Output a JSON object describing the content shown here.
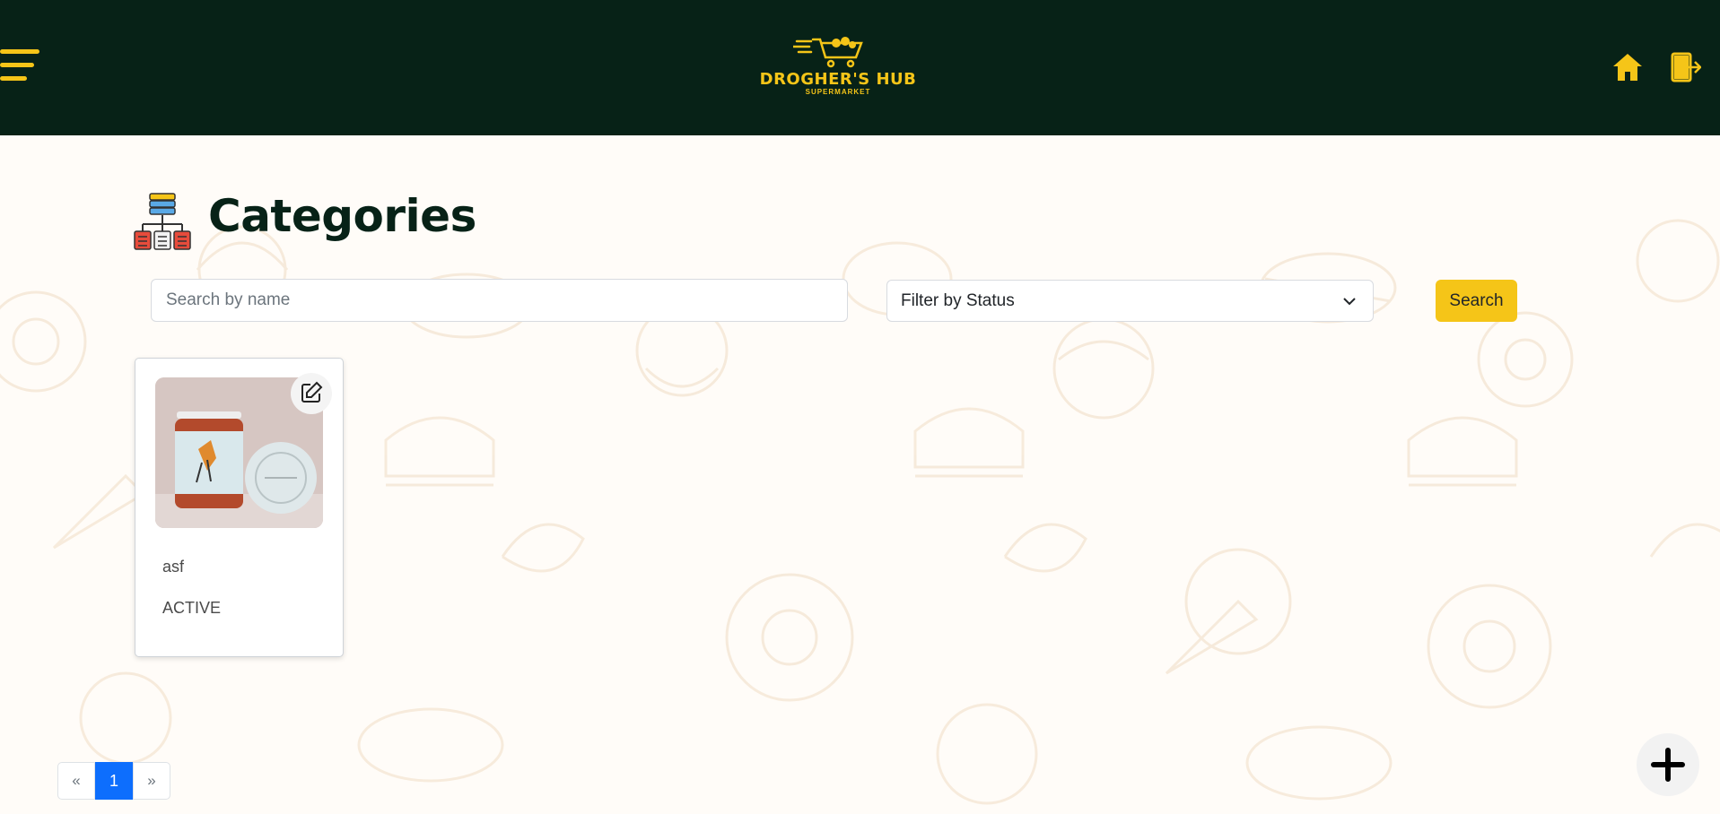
{
  "header": {
    "logo_title": "DROGHER'S HUB",
    "logo_subtitle": "SUPERMARKET",
    "brand_color": "#f5c518",
    "bg_color": "#072217",
    "menu_icon": "hamburger-icon",
    "home_icon": "home-icon",
    "logout_icon": "logout-icon"
  },
  "page": {
    "title": "Categories",
    "title_icon": "category-hierarchy-icon"
  },
  "filters": {
    "search_placeholder": "Search by name",
    "search_value": "",
    "status_selected": "Filter by Status",
    "search_button": "Search"
  },
  "categories": [
    {
      "name": "asf",
      "status": "ACTIVE",
      "image": "jar-product-photo",
      "edit_icon": "edit-icon"
    }
  ],
  "pagination": {
    "prev": "«",
    "current": "1",
    "next": "»"
  },
  "fab": {
    "icon": "plus-icon"
  }
}
